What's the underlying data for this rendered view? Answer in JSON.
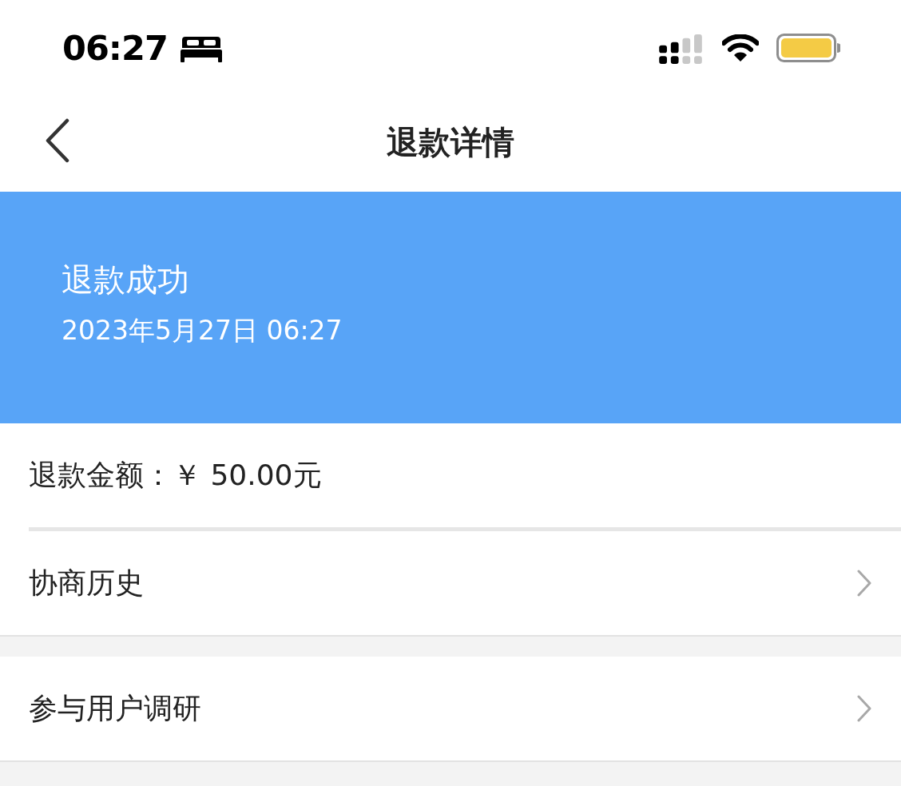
{
  "status_bar": {
    "time": "06:27"
  },
  "nav": {
    "title": "退款详情"
  },
  "banner": {
    "status": "退款成功",
    "time": "2023年5月27日 06:27"
  },
  "amount": {
    "text": "退款金额：￥ 50.00元"
  },
  "links": [
    {
      "label": "协商历史"
    },
    {
      "label": "参与用户调研"
    }
  ]
}
